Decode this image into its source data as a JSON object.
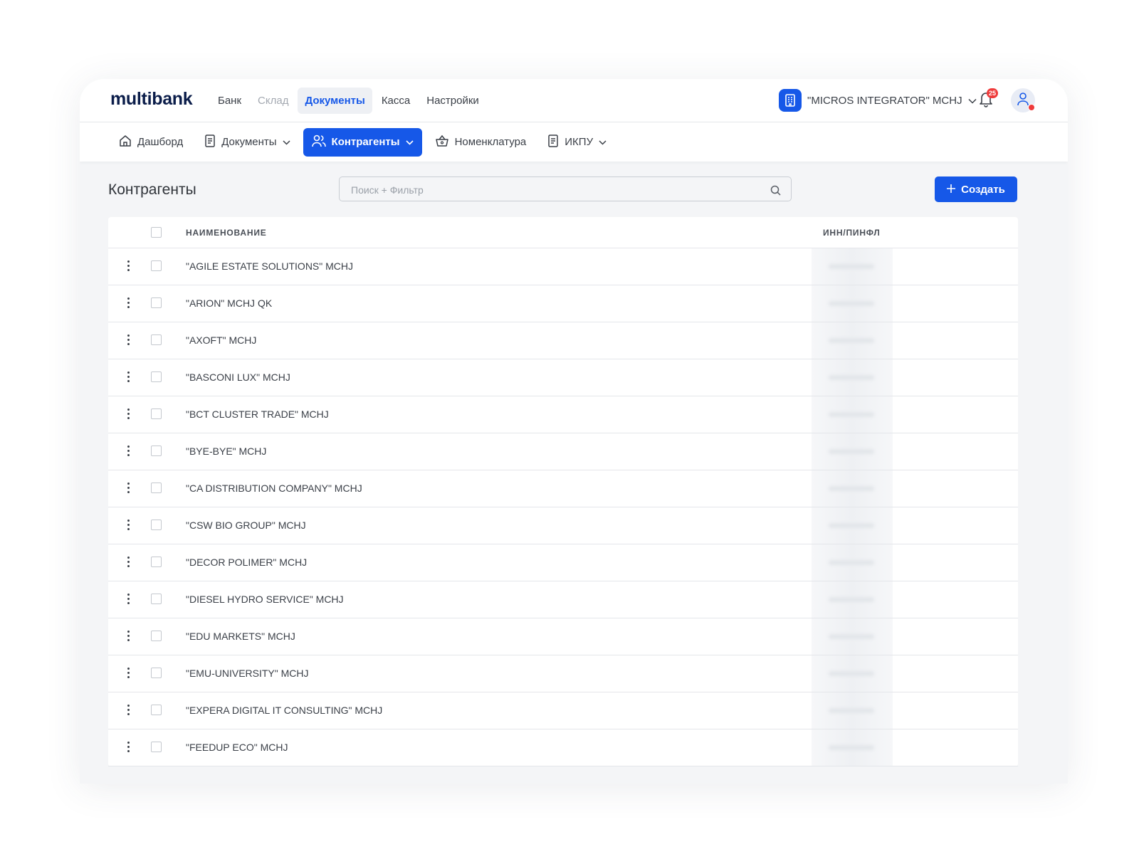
{
  "app": {
    "logo": "multibank"
  },
  "topnav": {
    "items": [
      {
        "label": "Банк",
        "state": "normal"
      },
      {
        "label": "Склад",
        "state": "muted"
      },
      {
        "label": "Документы",
        "state": "active"
      },
      {
        "label": "Касса",
        "state": "normal"
      },
      {
        "label": "Настройки",
        "state": "normal"
      }
    ]
  },
  "company": {
    "name": "\"MICROS INTEGRATOR\" MCHJ",
    "icon": "building-icon"
  },
  "notifications": {
    "count": "25",
    "icon": "bell-icon"
  },
  "user": {
    "icon": "user-icon"
  },
  "subnav": {
    "items": [
      {
        "label": "Дашборд",
        "icon": "home-icon",
        "dropdown": false,
        "active": false
      },
      {
        "label": "Документы",
        "icon": "document-icon",
        "dropdown": true,
        "active": false
      },
      {
        "label": "Контрагенты",
        "icon": "users-icon",
        "dropdown": true,
        "active": true
      },
      {
        "label": "Номенклатура",
        "icon": "basket-icon",
        "dropdown": false,
        "active": false
      },
      {
        "label": "ИКПУ",
        "icon": "document-icon",
        "dropdown": true,
        "active": false
      }
    ]
  },
  "page": {
    "title": "Контрагенты",
    "search_placeholder": "Поиск + Фильтр",
    "create_label": "Создать"
  },
  "table": {
    "columns": {
      "name": "НАИМЕНОВАНИЕ",
      "inn": "ИНН/ПИНФЛ"
    },
    "rows": [
      "\"AGILE ESTATE SOLUTIONS\" MCHJ",
      "\"ARION\" MCHJ QK",
      "\"AXOFT\" MCHJ",
      "\"BASCONI LUX\" MCHJ",
      "\"BCT CLUSTER TRADE\" MCHJ",
      "\"BYE-BYE\" MCHJ",
      "\"CA DISTRIBUTION COMPANY\" MCHJ",
      "\"CSW BIO GROUP\" MCHJ",
      "\"DECOR POLIMER\" MCHJ",
      "\"DIESEL HYDRO SERVICE\" MCHJ",
      "\"EDU MARKETS\" MCHJ",
      "\"EMU-UNIVERSITY\" MCHJ",
      "\"EXPERA DIGITAL IT CONSULTING\" MCHJ",
      "\"FEEDUP ECO\" MCHJ"
    ]
  },
  "colors": {
    "accent": "#1658e8",
    "badge": "#ef3b3b"
  }
}
